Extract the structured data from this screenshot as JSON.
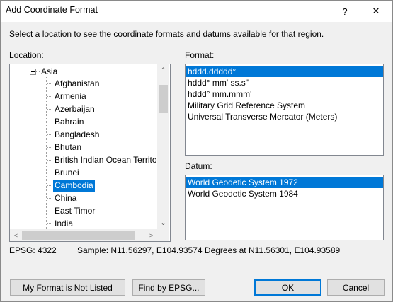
{
  "window": {
    "title": "Add Coordinate Format",
    "help_glyph": "?",
    "close_glyph": "✕"
  },
  "instruction": "Select a location to see the coordinate formats and datums available for that region.",
  "location": {
    "label_accel": "L",
    "label_rest": "ocation:",
    "tree": {
      "parent": "Asia",
      "children": [
        "Afghanistan",
        "Armenia",
        "Azerbaijan",
        "Bahrain",
        "Bangladesh",
        "Bhutan",
        "British Indian Ocean Territor",
        "Brunei",
        "Cambodia",
        "China",
        "East Timor",
        "India"
      ],
      "selected": "Cambodia"
    },
    "scroll_up_glyph": "⌃",
    "scroll_down_glyph": "⌄",
    "scroll_left_glyph": "<",
    "scroll_right_glyph": ">"
  },
  "format": {
    "label_accel": "F",
    "label_rest": "ormat:",
    "items": [
      "hddd.ddddd°",
      "hddd° mm' ss.s\"",
      "hddd° mm.mmm'",
      "Military Grid Reference System",
      "Universal Transverse Mercator (Meters)"
    ],
    "selected_index": 0
  },
  "datum": {
    "label_accel": "D",
    "label_rest": "atum:",
    "items": [
      "World Geodetic System 1972",
      "World Geodetic System 1984"
    ],
    "selected_index": 0
  },
  "epsg_text": "EPSG: 4322",
  "sample_text": "Sample: N11.56297, E104.93574 Degrees at N11.56301, E104.93589",
  "buttons": {
    "not_listed": "My Format is Not Listed",
    "find_epsg": "Find by EPSG...",
    "ok": "OK",
    "cancel": "Cancel"
  },
  "colors": {
    "selection": "#0078d7",
    "dialog_bg": "#f0f0f0"
  }
}
